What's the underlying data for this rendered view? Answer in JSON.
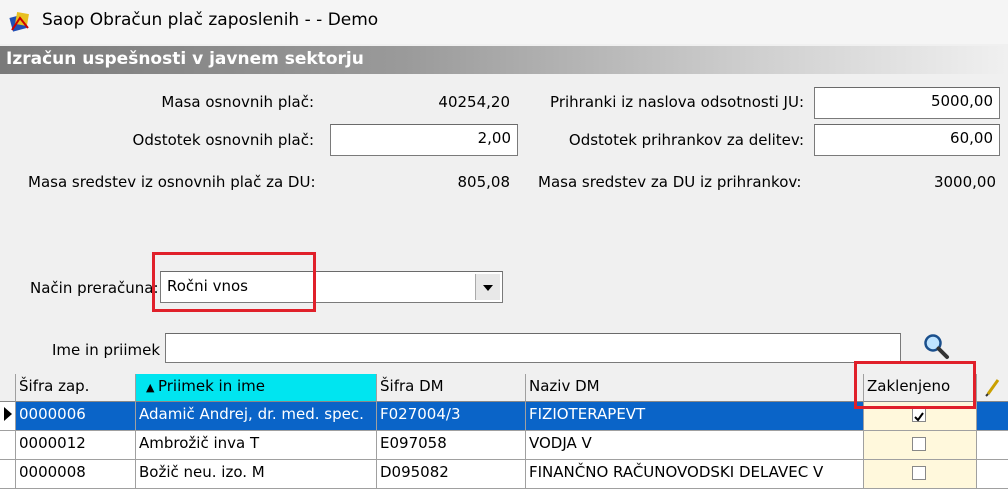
{
  "window": {
    "title": "Saop Obračun plač zaposlenih -  - Demo"
  },
  "section": {
    "title": "Izračun uspešnosti v javnem sektorju"
  },
  "form": {
    "masa_osnovnih_label": "Masa osnovnih plač:",
    "masa_osnovnih_value": "40254,20",
    "odstotek_osnovnih_label": "Odstotek osnovnih plač:",
    "odstotek_osnovnih_value": "2,00",
    "masa_sredstev_label": "Masa sredstev iz osnovnih plač za DU:",
    "masa_sredstev_value": "805,08",
    "prihranki_label": "Prihranki iz naslova odsotnosti JU:",
    "prihranki_value": "5000,00",
    "odstotek_prihrankov_label": "Odstotek prihrankov za delitev:",
    "odstotek_prihrankov_value": "60,00",
    "masa_prihrankov_label": "Masa sredstev za DU iz prihrankov:",
    "masa_prihrankov_value": "3000,00",
    "nacin_label": "Način preračuna:",
    "nacin_value": "Ročni vnos",
    "ime_label": "Ime in priimek",
    "ime_value": ""
  },
  "grid": {
    "columns": [
      "Šifra zap.",
      "Priimek in ime",
      "Šifra DM",
      "Naziv DM",
      "Zaklenjeno"
    ],
    "rows": [
      {
        "sifra": "0000006",
        "ime": "Adamič Andrej, dr. med. spec.",
        "sifra_dm": "F027004/3",
        "naziv_dm": "FIZIOTERAPEVT",
        "zaklenjeno": true
      },
      {
        "sifra": "0000012",
        "ime": "Ambrožič inva T",
        "sifra_dm": "E097058",
        "naziv_dm": "VODJA V",
        "zaklenjeno": false
      },
      {
        "sifra": "0000008",
        "ime": "Božič neu. izo. M",
        "sifra_dm": "D095082",
        "naziv_dm": "FINANČNO RAČUNOVODSKI DELAVEC V",
        "zaklenjeno": false
      }
    ]
  },
  "colors": {
    "selected_row": "#0a64c8",
    "sorted_header": "#00e5f0",
    "highlight_box": "#e0202a",
    "locked_bg": "#fff8dc"
  }
}
